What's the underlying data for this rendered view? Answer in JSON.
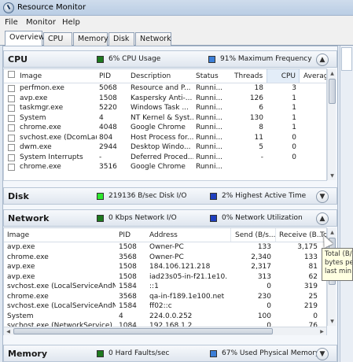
{
  "window": {
    "title": "Resource Monitor"
  },
  "menu": [
    "File",
    "Monitor",
    "Help"
  ],
  "tabs": [
    "Overview",
    "CPU",
    "Memory",
    "Disk",
    "Network"
  ],
  "colors": {
    "green": "#1e7a1e",
    "bright_green": "#2ee82e",
    "blue": "#1f3fbf",
    "light_blue": "#3c7fd8"
  },
  "cpu": {
    "title": "CPU",
    "usage": "6% CPU Usage",
    "frequency": "91% Maximum Frequency",
    "columns": [
      "Image",
      "PID",
      "Description",
      "Status",
      "Threads",
      "CPU",
      "Averag"
    ],
    "rows": [
      [
        "perfmon.exe",
        "5068",
        "Resource and P...",
        "Runni...",
        "18",
        "3"
      ],
      [
        "avp.exe",
        "1508",
        "Kaspersky Anti-...",
        "Runni...",
        "126",
        "1"
      ],
      [
        "taskmgr.exe",
        "5220",
        "Windows Task ...",
        "Runni...",
        "6",
        "1"
      ],
      [
        "System",
        "4",
        "NT Kernel & Syst...",
        "Runni...",
        "130",
        "1"
      ],
      [
        "chrome.exe",
        "4048",
        "Google Chrome",
        "Runni...",
        "8",
        "1"
      ],
      [
        "svchost.exe (DcomLau...",
        "804",
        "Host Process for...",
        "Runni...",
        "11",
        "0"
      ],
      [
        "dwm.exe",
        "2944",
        "Desktop Windo...",
        "Runni...",
        "5",
        "0"
      ],
      [
        "System Interrupts",
        "-",
        "Deferred Proced...",
        "Runni...",
        "-",
        "0"
      ],
      [
        "chrome.exe",
        "3516",
        "Google Chrome",
        "Runni...",
        "",
        ""
      ]
    ]
  },
  "disk": {
    "title": "Disk",
    "io": "219136 B/sec Disk I/O",
    "active": "2% Highest Active Time"
  },
  "network": {
    "title": "Network",
    "io": "0 Kbps Network I/O",
    "utilization": "0% Network Utilization",
    "columns": [
      "Image",
      "PID",
      "Address",
      "Send (B/s...",
      "Receive (B...",
      "To"
    ],
    "rows": [
      [
        "avp.exe",
        "1508",
        "Owner-PC",
        "133",
        "3,175"
      ],
      [
        "chrome.exe",
        "3568",
        "Owner-PC",
        "2,340",
        "133"
      ],
      [
        "avp.exe",
        "1508",
        "184.106.121.218",
        "2,317",
        "81"
      ],
      [
        "avp.exe",
        "1508",
        "iad23s05-in-f21.1e10...",
        "313",
        "62"
      ],
      [
        "svchost.exe (LocalServiceAndNo...",
        "1584",
        "::1",
        "0",
        "319"
      ],
      [
        "chrome.exe",
        "3568",
        "qa-in-f189.1e100.net",
        "230",
        "25"
      ],
      [
        "svchost.exe (LocalServiceAndNo...",
        "1584",
        "ff02::c",
        "0",
        "219"
      ],
      [
        "System",
        "4",
        "224.0.0.252",
        "100",
        "0"
      ],
      [
        "svchost.exe (NetworkService)",
        "1084",
        "192.168.1.2",
        "0",
        "76"
      ]
    ]
  },
  "memory": {
    "title": "Memory",
    "faults": "0 Hard Faults/sec",
    "used": "67% Used Physical Memory"
  },
  "tooltip": {
    "lines": [
      "Total (B/",
      "bytes pe",
      "last min"
    ]
  }
}
